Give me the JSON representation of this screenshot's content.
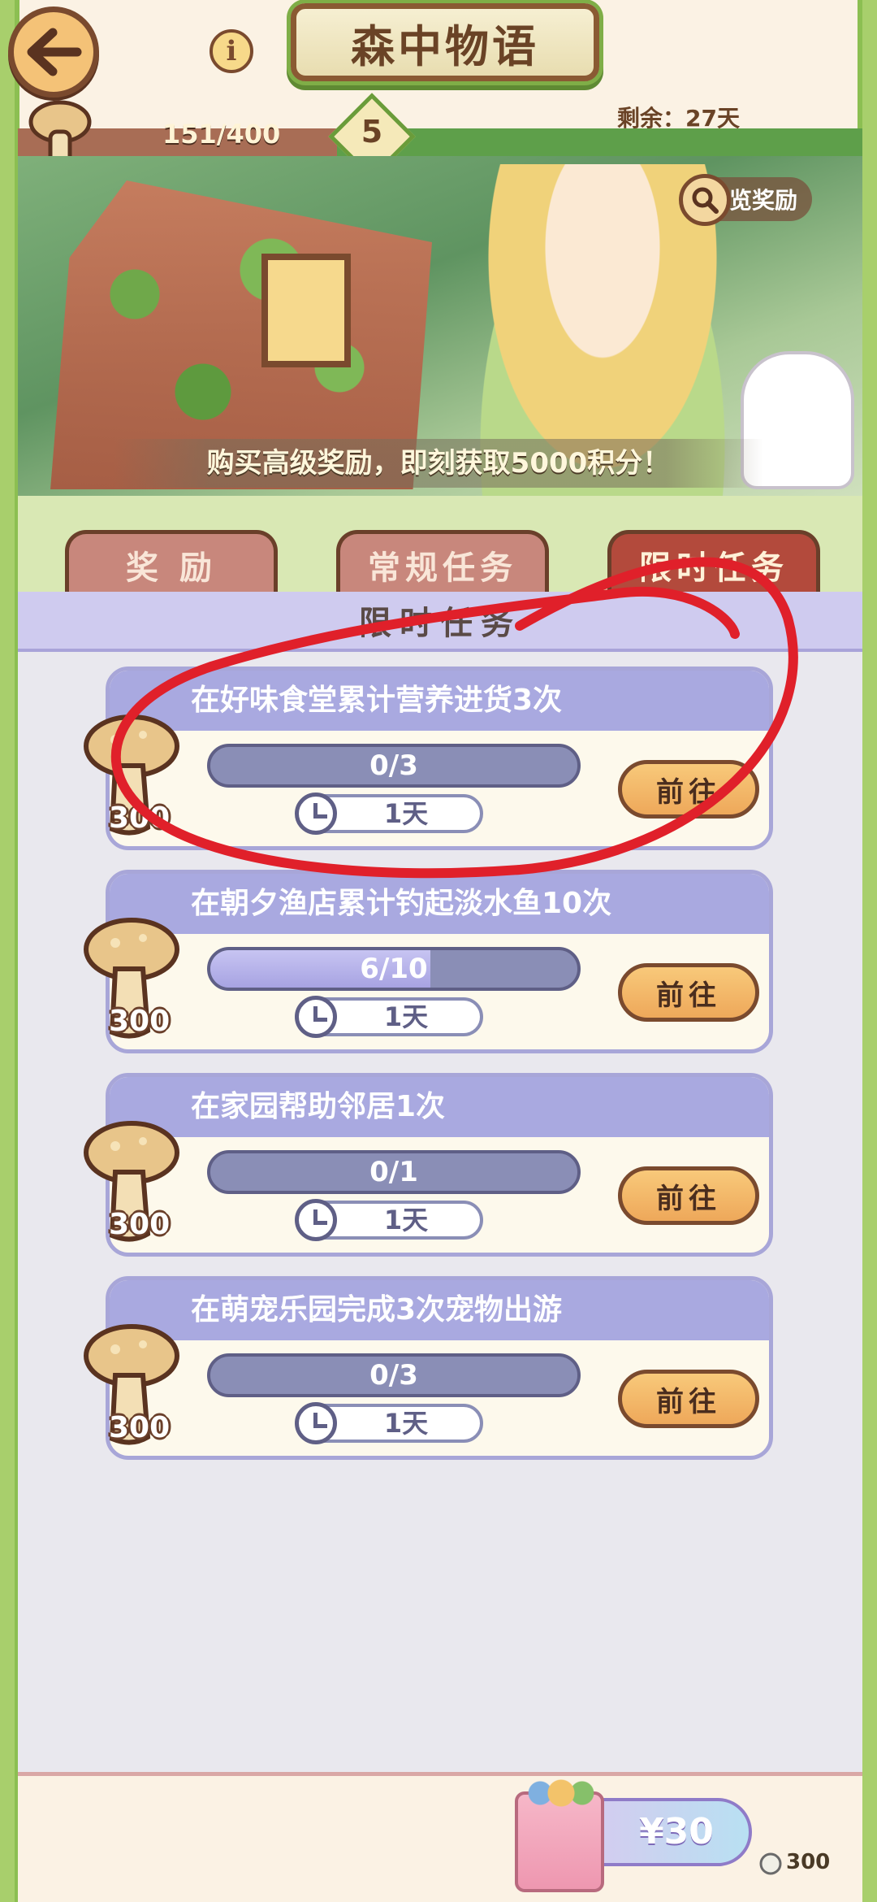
{
  "header": {
    "title": "森中物语",
    "remaining": "剩余：27天"
  },
  "level": {
    "progress_text": "151/400",
    "progress_fraction": 0.3775,
    "level": "5"
  },
  "banner": {
    "preview_label": "预览奖励",
    "caption": "购买高级奖励，即刻获取5000积分！"
  },
  "tabs": [
    {
      "label": "奖 励",
      "active": false
    },
    {
      "label": "常规任务",
      "active": false
    },
    {
      "label": "限时任务",
      "active": true
    }
  ],
  "section": {
    "title": "限时任务"
  },
  "tasks": [
    {
      "title": "在好味食堂累计营养进货3次",
      "progress": "0/3",
      "fraction": 0.0,
      "time": "1天",
      "reward": "300",
      "button": "前往"
    },
    {
      "title": "在朝夕渔店累计钓起淡水鱼10次",
      "progress": "6/10",
      "fraction": 0.6,
      "time": "1天",
      "reward": "300",
      "button": "前往"
    },
    {
      "title": "在家园帮助邻居1次",
      "progress": "0/1",
      "fraction": 0.0,
      "time": "1天",
      "reward": "300",
      "button": "前往"
    },
    {
      "title": "在萌宠乐园完成3次宠物出游",
      "progress": "0/3",
      "fraction": 0.0,
      "time": "1天",
      "reward": "300",
      "button": "前往"
    }
  ],
  "purchase": {
    "price": "¥30",
    "token_count": "300"
  },
  "colors": {
    "annotation": "#e0202a",
    "accent": "#b34a3c",
    "frame_green": "#8cbf52"
  },
  "icons": {
    "back": "arrow-left-icon",
    "info": "info-icon",
    "preview": "magnifier-icon",
    "timer": "clock-icon",
    "reward": "mushroom-icon"
  }
}
